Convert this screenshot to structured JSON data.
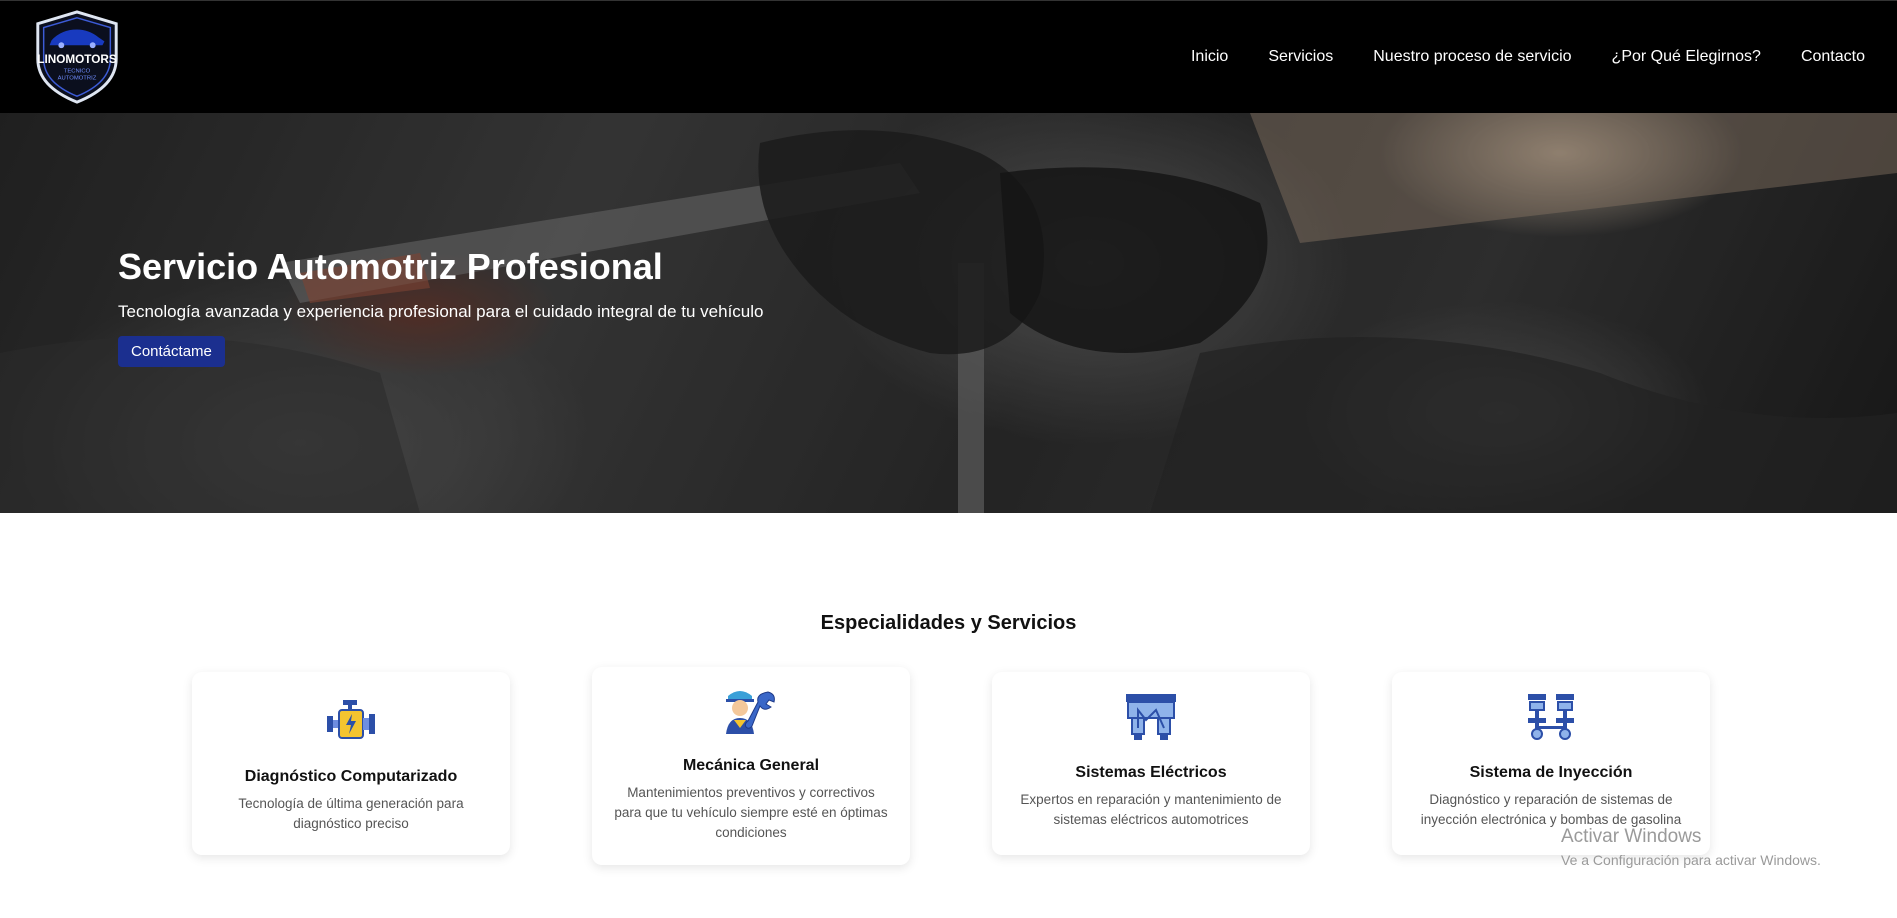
{
  "brand": {
    "name": "LINOMOTORS",
    "tagline_line1": "TECNICO",
    "tagline_line2": "AUTOMOTRIZ"
  },
  "nav": {
    "items": [
      {
        "label": "Inicio"
      },
      {
        "label": "Servicios"
      },
      {
        "label": "Nuestro proceso de servicio"
      },
      {
        "label": "¿Por Qué Elegirnos?"
      },
      {
        "label": "Contacto"
      }
    ]
  },
  "hero": {
    "title": "Servicio Automotriz Profesional",
    "subtitle": "Tecnología avanzada y experiencia profesional para el cuidado integral de tu vehículo",
    "button_label": "Contáctame"
  },
  "services": {
    "title": "Especialidades y Servicios",
    "cards": [
      {
        "icon": "engine-icon",
        "title": "Diagnóstico Computarizado",
        "description": "Tecnología de última generación para diagnóstico preciso"
      },
      {
        "icon": "mechanic-icon",
        "title": "Mecánica General",
        "description": "Mantenimientos preventivos y correctivos para que tu vehículo siempre esté en óptimas condiciones"
      },
      {
        "icon": "fuse-icon",
        "title": "Sistemas Eléctricos",
        "description": "Expertos en reparación y mantenimiento de sistemas eléctricos automotrices"
      },
      {
        "icon": "injection-icon",
        "title": "Sistema de Inyección",
        "description": "Diagnóstico y reparación de sistemas de inyección electrónica y bombas de gasolina"
      }
    ]
  },
  "watermark": {
    "title": "Activar Windows",
    "subtitle": "Ve a Configuración para activar Windows."
  },
  "colors": {
    "navbar": "#000000",
    "accent_button": "#1b2f8f",
    "icon_blue": "#2c4fa8",
    "icon_yellow": "#f4c430"
  }
}
